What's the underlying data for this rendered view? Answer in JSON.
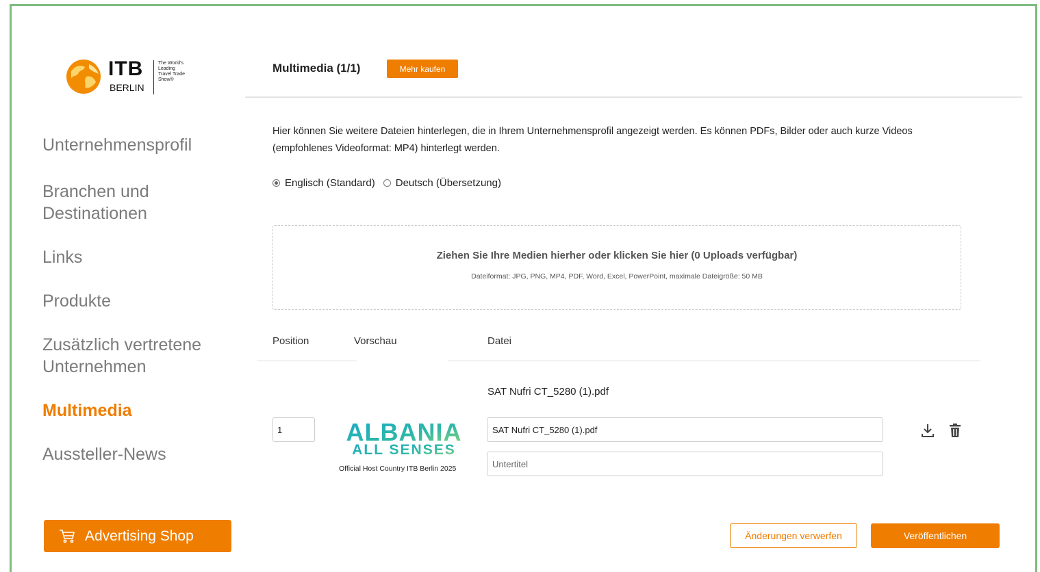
{
  "brand": {
    "name": "ITB",
    "city": "BERLIN",
    "tagline": "The World's\nLeading\nTravel Trade\nShow®",
    "accent_color": "#ef7d00",
    "frame_color": "#7dbb7e"
  },
  "sidebar": {
    "items": [
      {
        "label": "Unternehmensprofil",
        "active": false
      },
      {
        "label": "Branchen und Destinationen",
        "active": false
      },
      {
        "label": "Links",
        "active": false
      },
      {
        "label": "Produkte",
        "active": false
      },
      {
        "label": "Zusätzlich vertretene Unternehmen",
        "active": false
      },
      {
        "label": "Multimedia",
        "active": true
      },
      {
        "label": "Aussteller-News",
        "active": false
      }
    ],
    "shop_button": "Advertising Shop",
    "shop_icon": "cart-icon"
  },
  "header": {
    "title": "Multimedia (1/1)",
    "buy_more": "Mehr kaufen"
  },
  "intro": "Hier können Sie weitere Dateien hinterlegen, die in Ihrem Unternehmensprofil angezeigt werden. Es können PDFs, Bilder oder auch kurze Videos (empfohlenes Videoformat: MP4) hinterlegt werden.",
  "language": {
    "options": [
      {
        "label": "Englisch (Standard)",
        "selected": true
      },
      {
        "label": "Deutsch (Übersetzung)",
        "selected": false
      }
    ]
  },
  "dropzone": {
    "main": "Ziehen Sie Ihre Medien hierher oder klicken Sie hier (0 Uploads verfügbar)",
    "sub": "Dateiformat: JPG, PNG, MP4, PDF, Word, Excel, PowerPoint, maximale Dateigröße: 50 MB"
  },
  "table": {
    "columns": [
      "Position",
      "Vorschau",
      "Datei"
    ],
    "rows": [
      {
        "file_title": "SAT Nufri CT_5280 (1).pdf",
        "position": "1",
        "filename_value": "SAT Nufri CT_5280 (1).pdf",
        "subtitle_placeholder": "Untertitel",
        "preview_line1": "ALBANIA",
        "preview_line2": "ALL SENSES",
        "preview_caption": "Official Host Country ITB Berlin 2025",
        "actions": [
          "download-icon",
          "trash-icon"
        ]
      }
    ]
  },
  "footer": {
    "discard": "Änderungen verwerfen",
    "publish": "Veröffentlichen"
  }
}
